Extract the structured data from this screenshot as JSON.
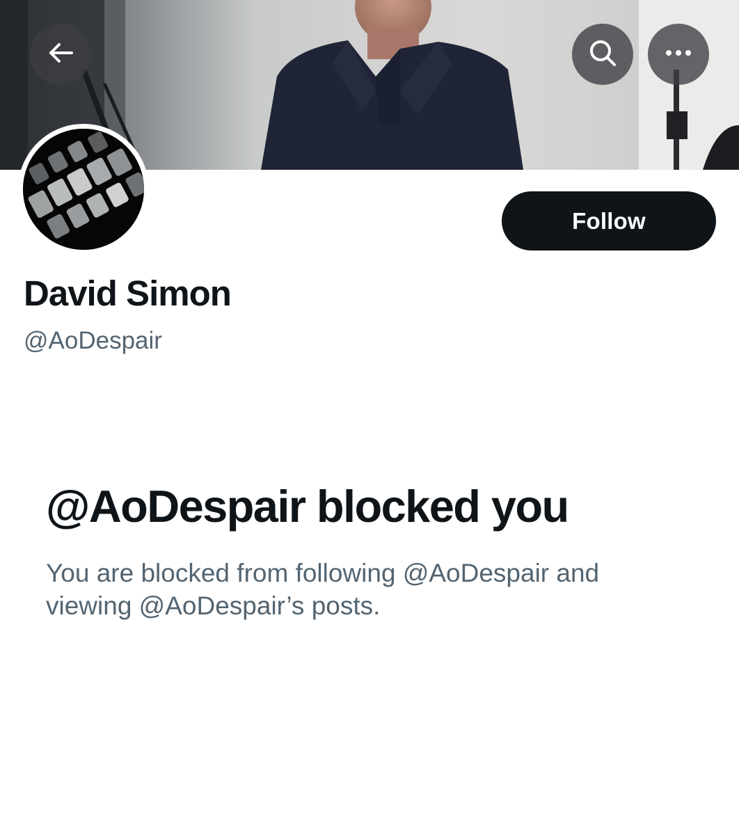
{
  "header": {
    "back_icon": "arrow-left-icon",
    "search_icon": "search-icon",
    "more_icon": "more-horizontal-icon"
  },
  "profile": {
    "display_name": "David Simon",
    "handle": "@AoDespair",
    "follow_label": "Follow"
  },
  "blocked": {
    "title": "@AoDespair blocked you",
    "description": "You are blocked from following @AoDespair and viewing @AoDespair’s posts."
  },
  "colors": {
    "primary_text": "#0f1419",
    "secondary_text": "#536471",
    "button_bg": "#0f1419",
    "button_text": "#ffffff",
    "background": "#ffffff"
  }
}
